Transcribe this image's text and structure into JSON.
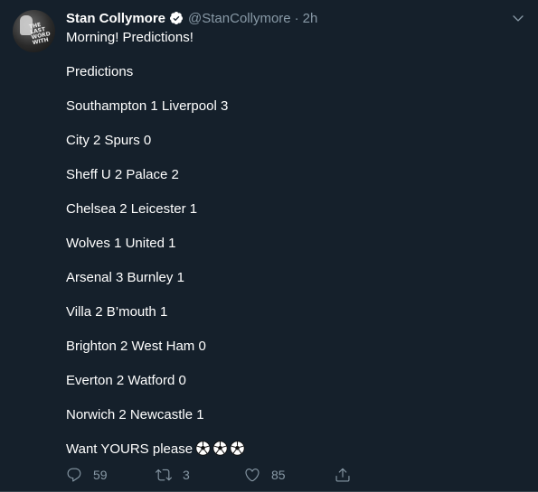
{
  "author": {
    "name": "Stan Collymore",
    "handle": "@StanCollymore",
    "separator": "·",
    "time": "2h",
    "avatar_text": "THE LAST WORD WITH"
  },
  "tweet": {
    "lines": [
      "Morning! Predictions!",
      "Predictions",
      "Southampton 1 Liverpool 3",
      "City 2 Spurs 0",
      "Sheff U 2 Palace 2",
      "Chelsea 2 Leicester 1",
      "Wolves 1 United 1",
      "Arsenal 3 Burnley 1",
      "Villa 2 B’mouth 1",
      "Brighton 2 West Ham 0",
      "Everton 2 Watford 0",
      "Norwich 2 Newcastle 1",
      "Want YOURS please"
    ],
    "emoji": "soccer-ball-icon"
  },
  "actions": {
    "reply_count": "59",
    "retweet_count": "3",
    "like_count": "85"
  },
  "colors": {
    "background": "#15202b",
    "secondary_text": "#8899a6",
    "verified": "#ffffff"
  }
}
